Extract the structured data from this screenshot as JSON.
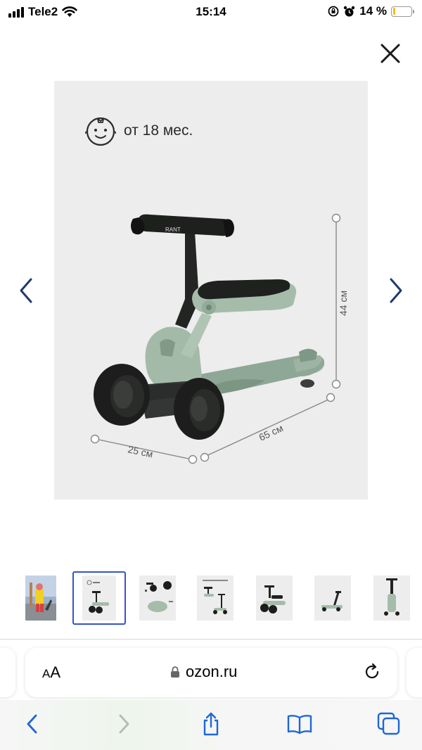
{
  "status_bar": {
    "carrier": "Tele2",
    "time": "15:14",
    "battery_percent": "14 %",
    "battery_level": 0.14,
    "icons": [
      "signal-icon",
      "wifi-icon",
      "rotation-lock-icon",
      "alarm-icon",
      "battery-icon"
    ]
  },
  "viewer": {
    "age_label": "от 18 мес.",
    "dimensions": {
      "height": "44 см",
      "length": "65 см",
      "width": "25 см"
    },
    "brand_mark": "RANT",
    "thumbnail_count": 7,
    "selected_thumbnail": 1
  },
  "browser": {
    "text_size_label": "AA",
    "url": "ozon.ru"
  },
  "colors": {
    "accent": "#3355cc",
    "ios_blue": "#1f66d6",
    "scooter_green": "#9fb7a6",
    "background_gray": "#ededed"
  }
}
